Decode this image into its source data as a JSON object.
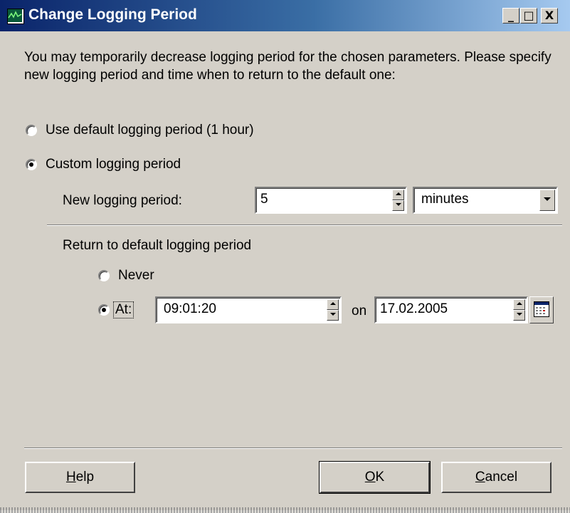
{
  "window": {
    "title": "Change Logging Period",
    "minimize_symbol": "_",
    "maximize_symbol": "□",
    "close_symbol": "X"
  },
  "description": "You may temporarily decrease logging period for the chosen parameters. Please specify new logging period and time when to return to the default one:",
  "options": {
    "default_period_label": "Use default logging period (1 hour)",
    "default_period_selected": false,
    "custom_period_label": "Custom logging period",
    "custom_period_selected": true
  },
  "new_period": {
    "label": "New logging period:",
    "value": "5",
    "unit": "minutes"
  },
  "return_section": {
    "label": "Return to default logging period",
    "never_label": "Never",
    "never_selected": false,
    "at_label": "At:",
    "at_selected": true,
    "time_value": "09:01:20",
    "on_label": "on",
    "date_value": "17.02.2005"
  },
  "buttons": {
    "help_label": "Help",
    "help_mnemonic": "H",
    "help_rest": "elp",
    "ok_label": "OK",
    "ok_mnemonic": "O",
    "ok_rest": "K",
    "cancel_label": "Cancel",
    "cancel_mnemonic": "C",
    "cancel_rest": "ancel"
  },
  "icons": [
    "app-monitor-icon",
    "calendar-icon",
    "spin-up-icon",
    "spin-down-icon",
    "dropdown-arrow-icon"
  ]
}
